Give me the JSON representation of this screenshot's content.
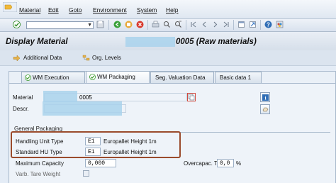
{
  "menu": {
    "items": [
      "Material",
      "Edit",
      "Goto",
      "Environment",
      "System",
      "Help"
    ]
  },
  "title": {
    "prefix": "Display Material",
    "suffix": "0005 (Raw materials)"
  },
  "app_toolbar": {
    "additional_data": "Additional Data",
    "org_levels": "Org. Levels"
  },
  "tabs": [
    {
      "label": "WM Execution",
      "checked": true
    },
    {
      "label": "WM Packaging",
      "checked": true,
      "active": true
    },
    {
      "label": "Seg. Valuation Data",
      "checked": false
    },
    {
      "label": "Basic data 1",
      "checked": false
    }
  ],
  "header": {
    "material_label": "Material",
    "material_value": "0005",
    "descr_label": "Descr."
  },
  "general_packaging": {
    "title": "General Packaging",
    "handling_unit_type_label": "Handling Unit Type",
    "handling_unit_type_value": "E1",
    "handling_unit_type_text": "Europallet Height 1m",
    "standard_hu_type_label": "Standard HU Type",
    "standard_hu_type_value": "E1",
    "standard_hu_type_text": "Europallet Height 1m",
    "maximum_capacity_label": "Maximum Capacity",
    "maximum_capacity_value": "0,000",
    "overcapac_tol_label": "Overcapac. Tol.",
    "overcapac_tol_value": "0,0",
    "overcapac_tol_unit": "%",
    "varb_tare_weight_label": "Varb. Tare Weight"
  },
  "colors": {
    "highlight_border": "#9a4b2c",
    "redaction": "#a9d2ec",
    "check_green": "#3a9a2b"
  }
}
